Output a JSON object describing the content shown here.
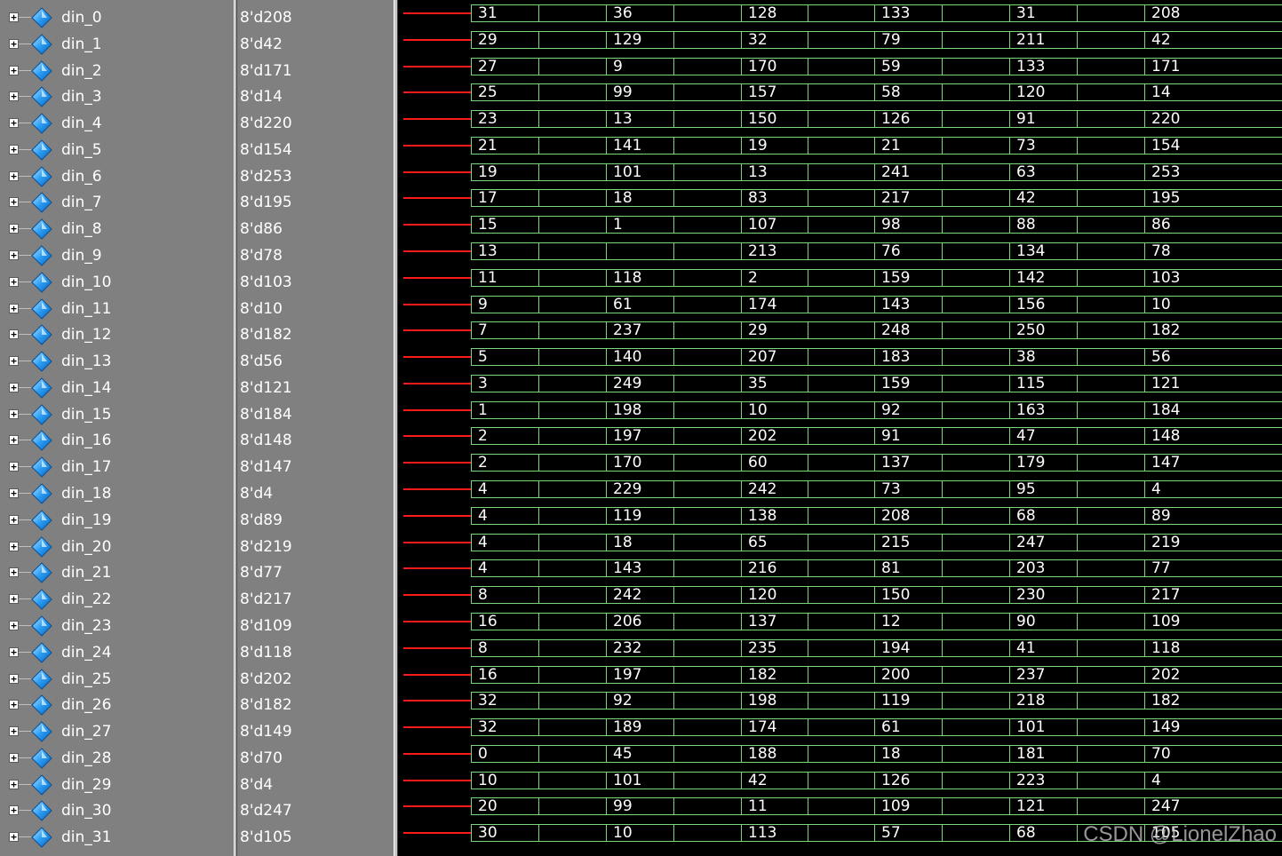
{
  "signals": [
    {
      "name": "din_0",
      "value": "8'd208",
      "values": [
        "31",
        "36",
        "128",
        "133",
        "31",
        "208"
      ]
    },
    {
      "name": "din_1",
      "value": "8'd42",
      "values": [
        "29",
        "129",
        "32",
        "79",
        "211",
        "42"
      ]
    },
    {
      "name": "din_2",
      "value": "8'd171",
      "values": [
        "27",
        "9",
        "170",
        "59",
        "133",
        "171"
      ]
    },
    {
      "name": "din_3",
      "value": "8'd14",
      "values": [
        "25",
        "99",
        "157",
        "58",
        "120",
        "14"
      ]
    },
    {
      "name": "din_4",
      "value": "8'd220",
      "values": [
        "23",
        "13",
        "150",
        "126",
        "91",
        "220"
      ]
    },
    {
      "name": "din_5",
      "value": "8'd154",
      "values": [
        "21",
        "141",
        "19",
        "21",
        "73",
        "154"
      ]
    },
    {
      "name": "din_6",
      "value": "8'd253",
      "values": [
        "19",
        "101",
        "13",
        "241",
        "63",
        "253"
      ]
    },
    {
      "name": "din_7",
      "value": "8'd195",
      "values": [
        "17",
        "18",
        "83",
        "217",
        "42",
        "195"
      ]
    },
    {
      "name": "din_8",
      "value": "8'd86",
      "values": [
        "15",
        "1",
        "107",
        "98",
        "88",
        "86"
      ]
    },
    {
      "name": "din_9",
      "value": "8'd78",
      "values": [
        "13",
        "",
        "213",
        "76",
        "134",
        "78"
      ]
    },
    {
      "name": "din_10",
      "value": "8'd103",
      "values": [
        "11",
        "118",
        "2",
        "159",
        "142",
        "103"
      ]
    },
    {
      "name": "din_11",
      "value": "8'd10",
      "values": [
        "9",
        "61",
        "174",
        "143",
        "156",
        "10"
      ]
    },
    {
      "name": "din_12",
      "value": "8'd182",
      "values": [
        "7",
        "237",
        "29",
        "248",
        "250",
        "182"
      ]
    },
    {
      "name": "din_13",
      "value": "8'd56",
      "values": [
        "5",
        "140",
        "207",
        "183",
        "38",
        "56"
      ]
    },
    {
      "name": "din_14",
      "value": "8'd121",
      "values": [
        "3",
        "249",
        "35",
        "159",
        "115",
        "121"
      ]
    },
    {
      "name": "din_15",
      "value": "8'd184",
      "values": [
        "1",
        "198",
        "10",
        "92",
        "163",
        "184"
      ]
    },
    {
      "name": "din_16",
      "value": "8'd148",
      "values": [
        "2",
        "197",
        "202",
        "91",
        "47",
        "148"
      ]
    },
    {
      "name": "din_17",
      "value": "8'd147",
      "values": [
        "2",
        "170",
        "60",
        "137",
        "179",
        "147"
      ]
    },
    {
      "name": "din_18",
      "value": "8'd4",
      "values": [
        "4",
        "229",
        "242",
        "73",
        "95",
        "4"
      ]
    },
    {
      "name": "din_19",
      "value": "8'd89",
      "values": [
        "4",
        "119",
        "138",
        "208",
        "68",
        "89"
      ]
    },
    {
      "name": "din_20",
      "value": "8'd219",
      "values": [
        "4",
        "18",
        "65",
        "215",
        "247",
        "219"
      ]
    },
    {
      "name": "din_21",
      "value": "8'd77",
      "values": [
        "4",
        "143",
        "216",
        "81",
        "203",
        "77"
      ]
    },
    {
      "name": "din_22",
      "value": "8'd217",
      "values": [
        "8",
        "242",
        "120",
        "150",
        "230",
        "217"
      ]
    },
    {
      "name": "din_23",
      "value": "8'd109",
      "values": [
        "16",
        "206",
        "137",
        "12",
        "90",
        "109"
      ]
    },
    {
      "name": "din_24",
      "value": "8'd118",
      "values": [
        "8",
        "232",
        "235",
        "194",
        "41",
        "118"
      ]
    },
    {
      "name": "din_25",
      "value": "8'd202",
      "values": [
        "16",
        "197",
        "182",
        "200",
        "237",
        "202"
      ]
    },
    {
      "name": "din_26",
      "value": "8'd182",
      "values": [
        "32",
        "92",
        "198",
        "119",
        "218",
        "182"
      ]
    },
    {
      "name": "din_27",
      "value": "8'd149",
      "values": [
        "32",
        "189",
        "174",
        "61",
        "101",
        "149"
      ]
    },
    {
      "name": "din_28",
      "value": "8'd70",
      "values": [
        "0",
        "45",
        "188",
        "18",
        "181",
        "70"
      ]
    },
    {
      "name": "din_29",
      "value": "8'd4",
      "values": [
        "10",
        "101",
        "42",
        "126",
        "223",
        "4"
      ]
    },
    {
      "name": "din_30",
      "value": "8'd247",
      "values": [
        "20",
        "99",
        "11",
        "109",
        "121",
        "247"
      ]
    },
    {
      "name": "din_31",
      "value": "8'd105",
      "values": [
        "30",
        "10",
        "113",
        "57",
        "68",
        "105"
      ]
    }
  ],
  "watermark": "CSDN @LionelZhao",
  "colors": {
    "pane_bg": "#808080",
    "wave_bg": "#000000",
    "bus": "#7ed67e",
    "undefined_line": "#ff1a1a",
    "text": "#ffffff",
    "icon": "#1e90ff"
  },
  "icons": {
    "expand": "plus-box-icon",
    "signal": "bus-diamond-icon"
  },
  "expand_glyph": "+"
}
